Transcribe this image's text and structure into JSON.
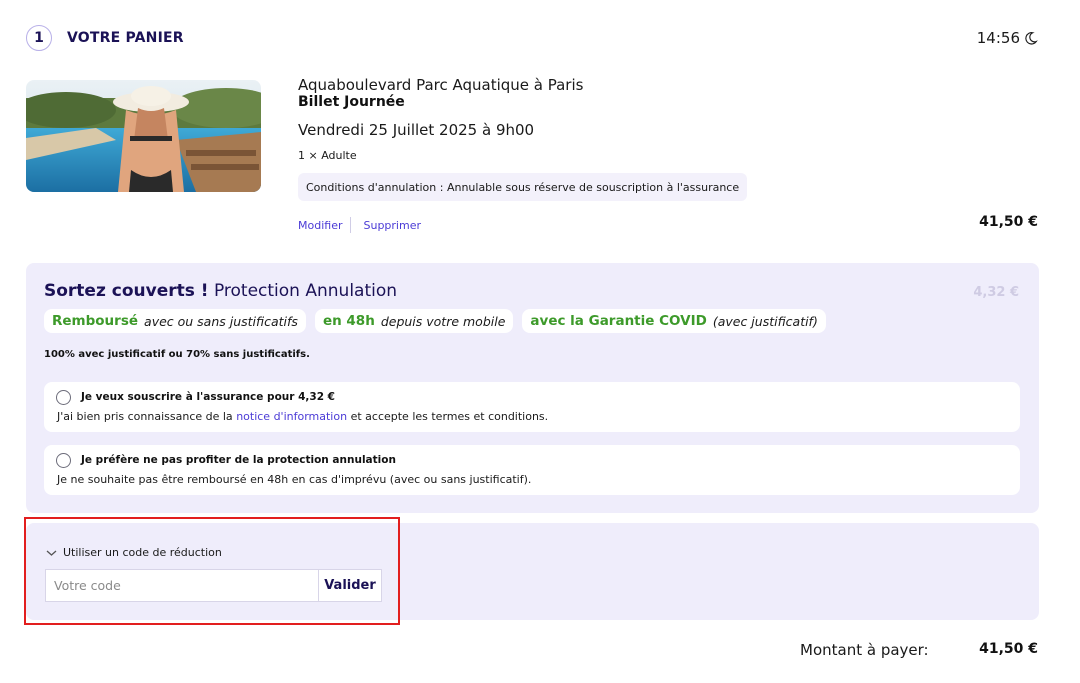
{
  "header": {
    "step_number": "1",
    "title": "VOTRE PANIER",
    "timer": "14:56"
  },
  "item": {
    "name": "Aquaboulevard Parc Aquatique à Paris",
    "ticket_type": "Billet Journée",
    "date": "Vendredi 25 Juillet 2025 à 9h00",
    "quantity": "1 × Adulte",
    "conditions": "Conditions d'annulation : Annulable sous réserve de souscription à l'assurance",
    "modify_label": "Modifier",
    "delete_label": "Supprimer",
    "price": "41,50 €"
  },
  "protection": {
    "title_bold": "Sortez couverts !",
    "title_rest": "Protection Annulation",
    "price": "4,32 €",
    "chips": [
      {
        "strong": "Remboursé",
        "italic": "avec ou sans justificatifs"
      },
      {
        "strong": "en 48h",
        "italic": "depuis votre mobile"
      },
      {
        "strong": "avec la Garantie COVID",
        "italic": "(avec justificatif)"
      }
    ],
    "note": "100% avec justificatif ou 70% sans justificatifs.",
    "option_yes": {
      "title": "Je veux souscrire à l'assurance pour 4,32 €",
      "desc_before": "J'ai bien pris connaissance de la",
      "desc_link": "notice d'information",
      "desc_after": "et accepte les termes et conditions."
    },
    "option_no": {
      "title": "Je préfère ne pas profiter de la protection annulation",
      "desc": "Je ne souhaite pas être remboursé en 48h en cas d'imprévu (avec ou sans justificatif)."
    }
  },
  "promo": {
    "toggle_label": "Utiliser un code de réduction",
    "placeholder": "Votre code",
    "submit_label": "Valider"
  },
  "total": {
    "label": "Montant à payer:",
    "value": "41,50 €"
  },
  "colors": {
    "accent": "#4b3bd6",
    "navy": "#1b1256",
    "green": "#3d9a2a",
    "panel": "#efedfb",
    "highlight": "#e21e1e"
  }
}
